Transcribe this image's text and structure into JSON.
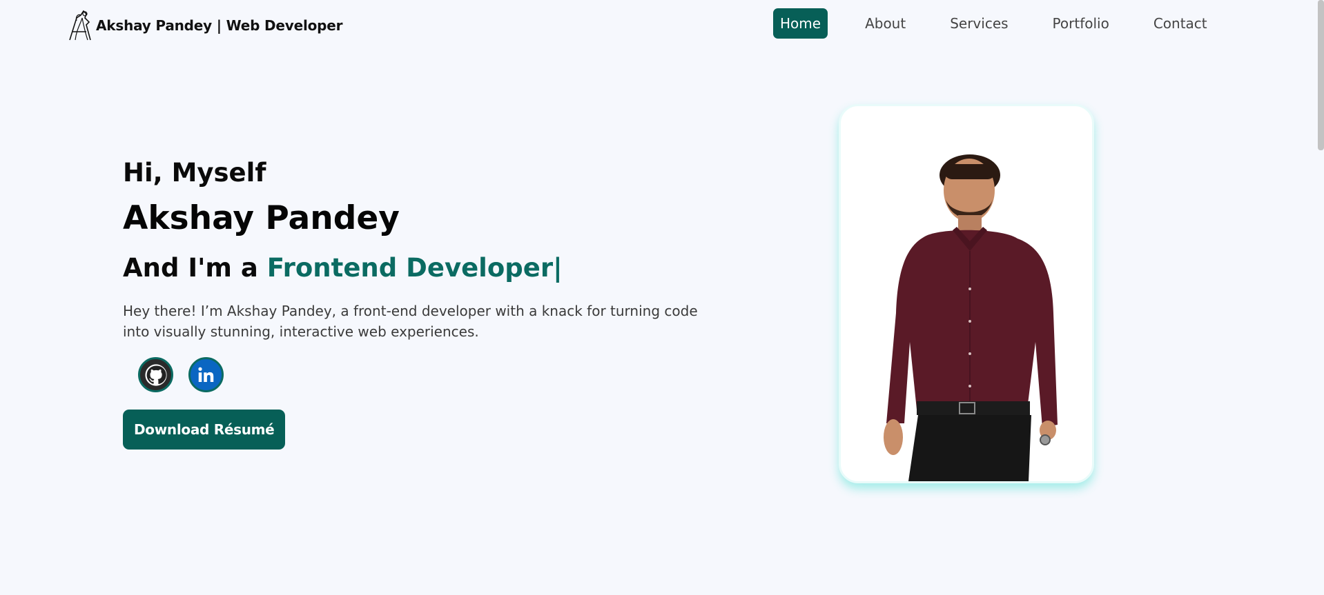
{
  "header": {
    "brand_title": "Akshay Pandey | Web Developer",
    "nav": [
      {
        "label": "Home",
        "active": true
      },
      {
        "label": "About",
        "active": false
      },
      {
        "label": "Services",
        "active": false
      },
      {
        "label": "Portfolio",
        "active": false
      },
      {
        "label": "Contact",
        "active": false
      }
    ]
  },
  "hero": {
    "greeting": "Hi, Myself",
    "name": "Akshay Pandey",
    "role_prefix": "And I'm a ",
    "role": "Frontend Developer",
    "cursor": "|",
    "bio": "Hey there! I’m Akshay Pandey, a front-end developer with a knack for turning code into visually stunning, interactive web experiences.",
    "download_label": "Download Résumé",
    "socials": [
      {
        "icon": "github-icon"
      },
      {
        "icon": "linkedin-icon"
      }
    ]
  },
  "colors": {
    "accent": "#075f57",
    "accent_text": "#0b6b62",
    "background": "#f6f8fd",
    "portrait_glow": "#40e0d0"
  }
}
